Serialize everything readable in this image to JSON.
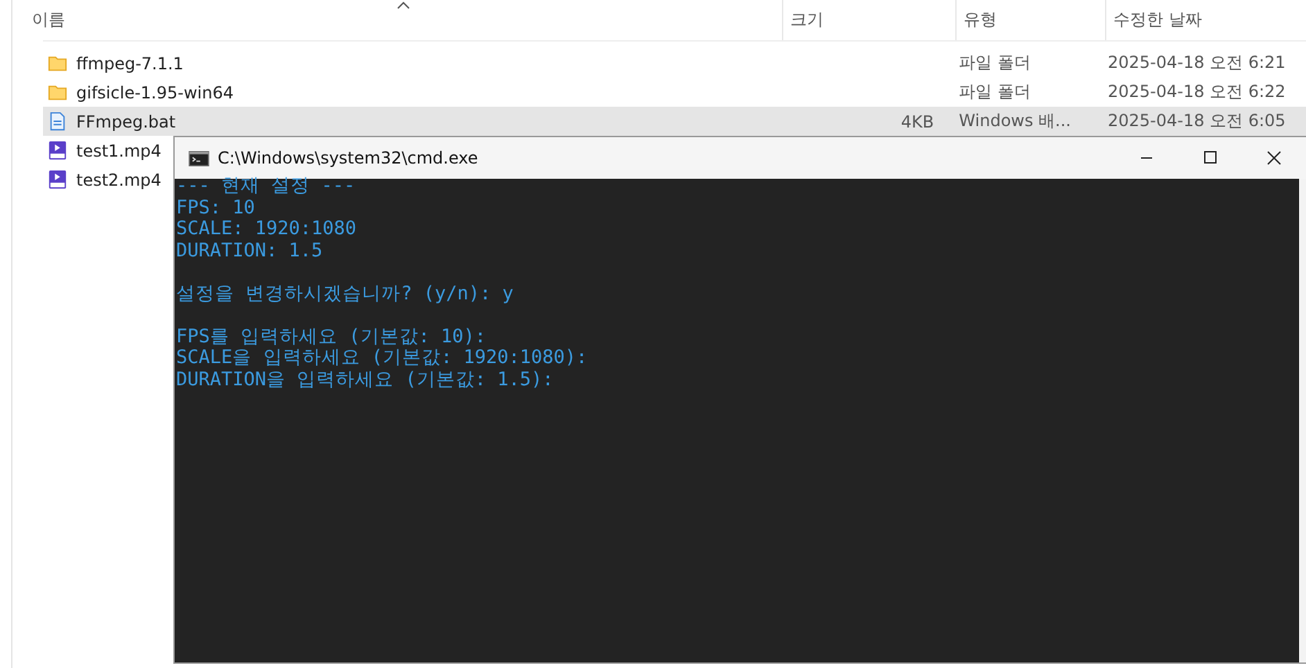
{
  "explorer": {
    "columns": [
      {
        "label": "이름",
        "sorted": true
      },
      {
        "label": "크기",
        "sorted": false
      },
      {
        "label": "유형",
        "sorted": false
      },
      {
        "label": "수정한 날짜",
        "sorted": false
      }
    ],
    "rows": [
      {
        "kind": "folder",
        "name": "ffmpeg-7.1.1",
        "type": "파일 폴더",
        "modified": "2025-04-18 오전 6:21",
        "selected": false
      },
      {
        "kind": "folder",
        "name": "gifsicle-1.95-win64",
        "type": "파일 폴더",
        "modified": "2025-04-18 오전 6:22",
        "selected": false
      },
      {
        "kind": "script",
        "name": "FFmpeg.bat",
        "size": "4KB",
        "type": "Windows 배...",
        "modified": "2025-04-18 오전 6:05",
        "selected": true
      },
      {
        "kind": "video",
        "name": "test1.mp4",
        "selected": false
      },
      {
        "kind": "video",
        "name": "test2.mp4",
        "selected": false
      }
    ]
  },
  "console": {
    "title": "C:\\Windows\\system32\\cmd.exe",
    "blocks": [
      [
        "--- 현재 설정 ---",
        "FPS: 10",
        "SCALE: 1920:1080",
        "DURATION: 1.5"
      ],
      [
        "설정을 변경하시겠습니까? (y/n): y"
      ],
      [
        "FPS를 입력하세요 (기본값: 10):",
        "SCALE을 입력하세요 (기본값: 1920:1080):",
        "DURATION을 입력하세요 (기본값: 1.5):"
      ]
    ]
  }
}
